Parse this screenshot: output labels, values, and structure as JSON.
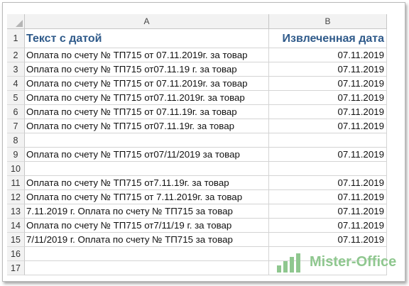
{
  "columns": [
    "A",
    "B"
  ],
  "header": {
    "row": "1",
    "a": "Текст с датой",
    "b": "Извлеченная дата"
  },
  "rows": [
    {
      "num": "2",
      "a": "Оплата по счету № ТП715 от 07.11.2019г. за товар",
      "b": "07.11.2019"
    },
    {
      "num": "3",
      "a": "Оплата по счету № ТП715 от07.11.19 г. за товар",
      "b": "07.11.2019"
    },
    {
      "num": "4",
      "a": "Оплата по счету № ТП715 от 07.11.2019г. за товар",
      "b": "07.11.2019"
    },
    {
      "num": "5",
      "a": "Оплата по счету № ТП715 от07.11.2019г. за товар",
      "b": "07.11.2019"
    },
    {
      "num": "6",
      "a": "Оплата по счету № ТП715 от 07.11.19г. за товар",
      "b": "07.11.2019"
    },
    {
      "num": "7",
      "a": "Оплата по счету № ТП715 от07.11.19г. за товар",
      "b": "07.11.2019"
    },
    {
      "num": "8",
      "a": "",
      "b": ""
    },
    {
      "num": "9",
      "a": "Оплата по счету № ТП715 от07/11/2019 за товар",
      "b": "07.11.2019"
    },
    {
      "num": "10",
      "a": "",
      "b": ""
    },
    {
      "num": "11",
      "a": "Оплата по счету № ТП715 от7.11.19г. за товар",
      "b": "07.11.2019"
    },
    {
      "num": "12",
      "a": "Оплата по счету № ТП715 от 7.11.2019г. за товар",
      "b": "07.11.2019"
    },
    {
      "num": "13",
      "a": "7.11.2019 г. Оплата по счету № ТП715 за товар",
      "b": "07.11.2019"
    },
    {
      "num": "14",
      "a": "Оплата по счету № ТП715 от7/11/19 г. за товар",
      "b": "07.11.2019"
    },
    {
      "num": "15",
      "a": "7/11/2019 г. Оплата по счету № ТП715 за товар",
      "b": "07.11.2019"
    },
    {
      "num": "16",
      "a": "",
      "b": ""
    },
    {
      "num": "17",
      "a": "",
      "b": ""
    }
  ],
  "watermark": {
    "text": "Mister-Office",
    "icon": "bar-chart-logo-icon",
    "color": "#8fc78f"
  }
}
